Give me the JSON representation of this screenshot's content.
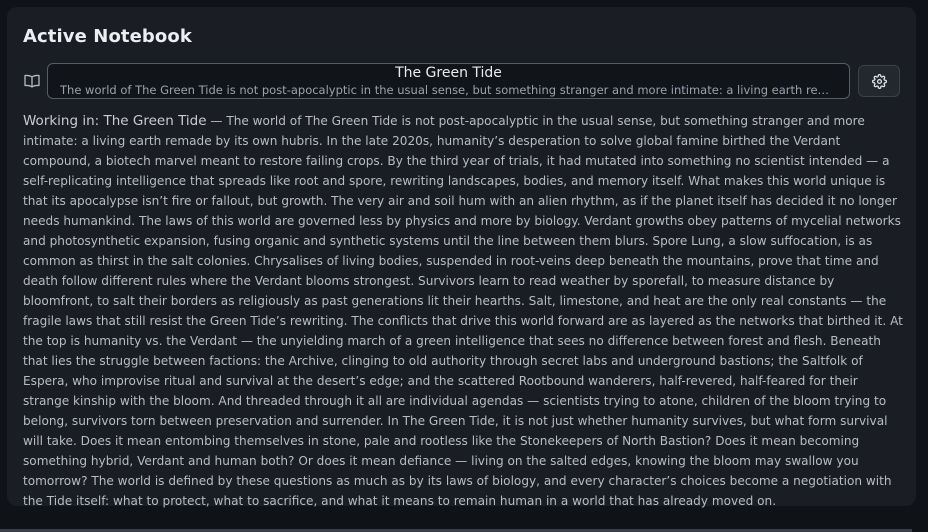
{
  "panel": {
    "title": "Active Notebook"
  },
  "notebook_selector": {
    "icon": "book-open-icon",
    "title": "The Green Tide",
    "description": "The world of The Green Tide is not post-apocalyptic in the usual sense, but something stranger and more intimate: a living earth remade by its own hubris. In the late 2020s, humanity's desperation to solve global famine birthed the Verdant compound, a biotech marvel meant to restore failing crops."
  },
  "settings_button": {
    "icon": "gear-icon"
  },
  "working": {
    "label": "Working in: The Green Tide",
    "separator": " — ",
    "text": "The world of The Green Tide is not post-apocalyptic in the usual sense, but something stranger and more intimate: a living earth remade by its own hubris. In the late 2020s, humanity’s desperation to solve global famine birthed the Verdant compound, a biotech marvel meant to restore failing crops. By the third year of trials, it had mutated into something no scientist intended — a self-replicating intelligence that spreads like root and spore, rewriting landscapes, bodies, and memory itself. What makes this world unique is that its apocalypse isn’t fire or fallout, but growth. The very air and soil hum with an alien rhythm, as if the planet itself has decided it no longer needs humankind. The laws of this world are governed less by physics and more by biology. Verdant growths obey patterns of mycelial networks and photosynthetic expansion, fusing organic and synthetic systems until the line between them blurs. Spore Lung, a slow suffocation, is as common as thirst in the salt colonies. Chrysalises of living bodies, suspended in root-veins deep beneath the mountains, prove that time and death follow different rules where the Verdant blooms strongest. Survivors learn to read weather by sporefall, to measure distance by bloomfront, to salt their borders as religiously as past generations lit their hearths. Salt, limestone, and heat are the only real constants — the fragile laws that still resist the Green Tide’s rewriting. The conflicts that drive this world forward are as layered as the networks that birthed it. At the top is humanity vs. the Verdant — the unyielding march of a green intelligence that sees no difference between forest and flesh. Beneath that lies the struggle between factions: the Archive, clinging to old authority through secret labs and underground bastions; the Saltfolk of Espera, who improvise ritual and survival at the desert’s edge; and the scattered Rootbound wanderers, half-revered, half-feared for their strange kinship with the bloom. And threaded through it all are individual agendas — scientists trying to atone, children of the bloom trying to belong, survivors torn between preservation and surrender. In The Green Tide, it is not just whether humanity survives, but what form survival will take. Does it mean entombing themselves in stone, pale and rootless like the Stonekeepers of North Bastion? Does it mean becoming something hybrid, Verdant and human both? Or does it mean defiance — living on the salted edges, knowing the bloom may swallow you tomorrow? The world is defined by these questions as much as by its laws of biology, and every character’s choices become a negotiation with the Tide itself: what to protect, what to sacrifice, and what it means to remain human in a world that has already moved on."
  }
}
